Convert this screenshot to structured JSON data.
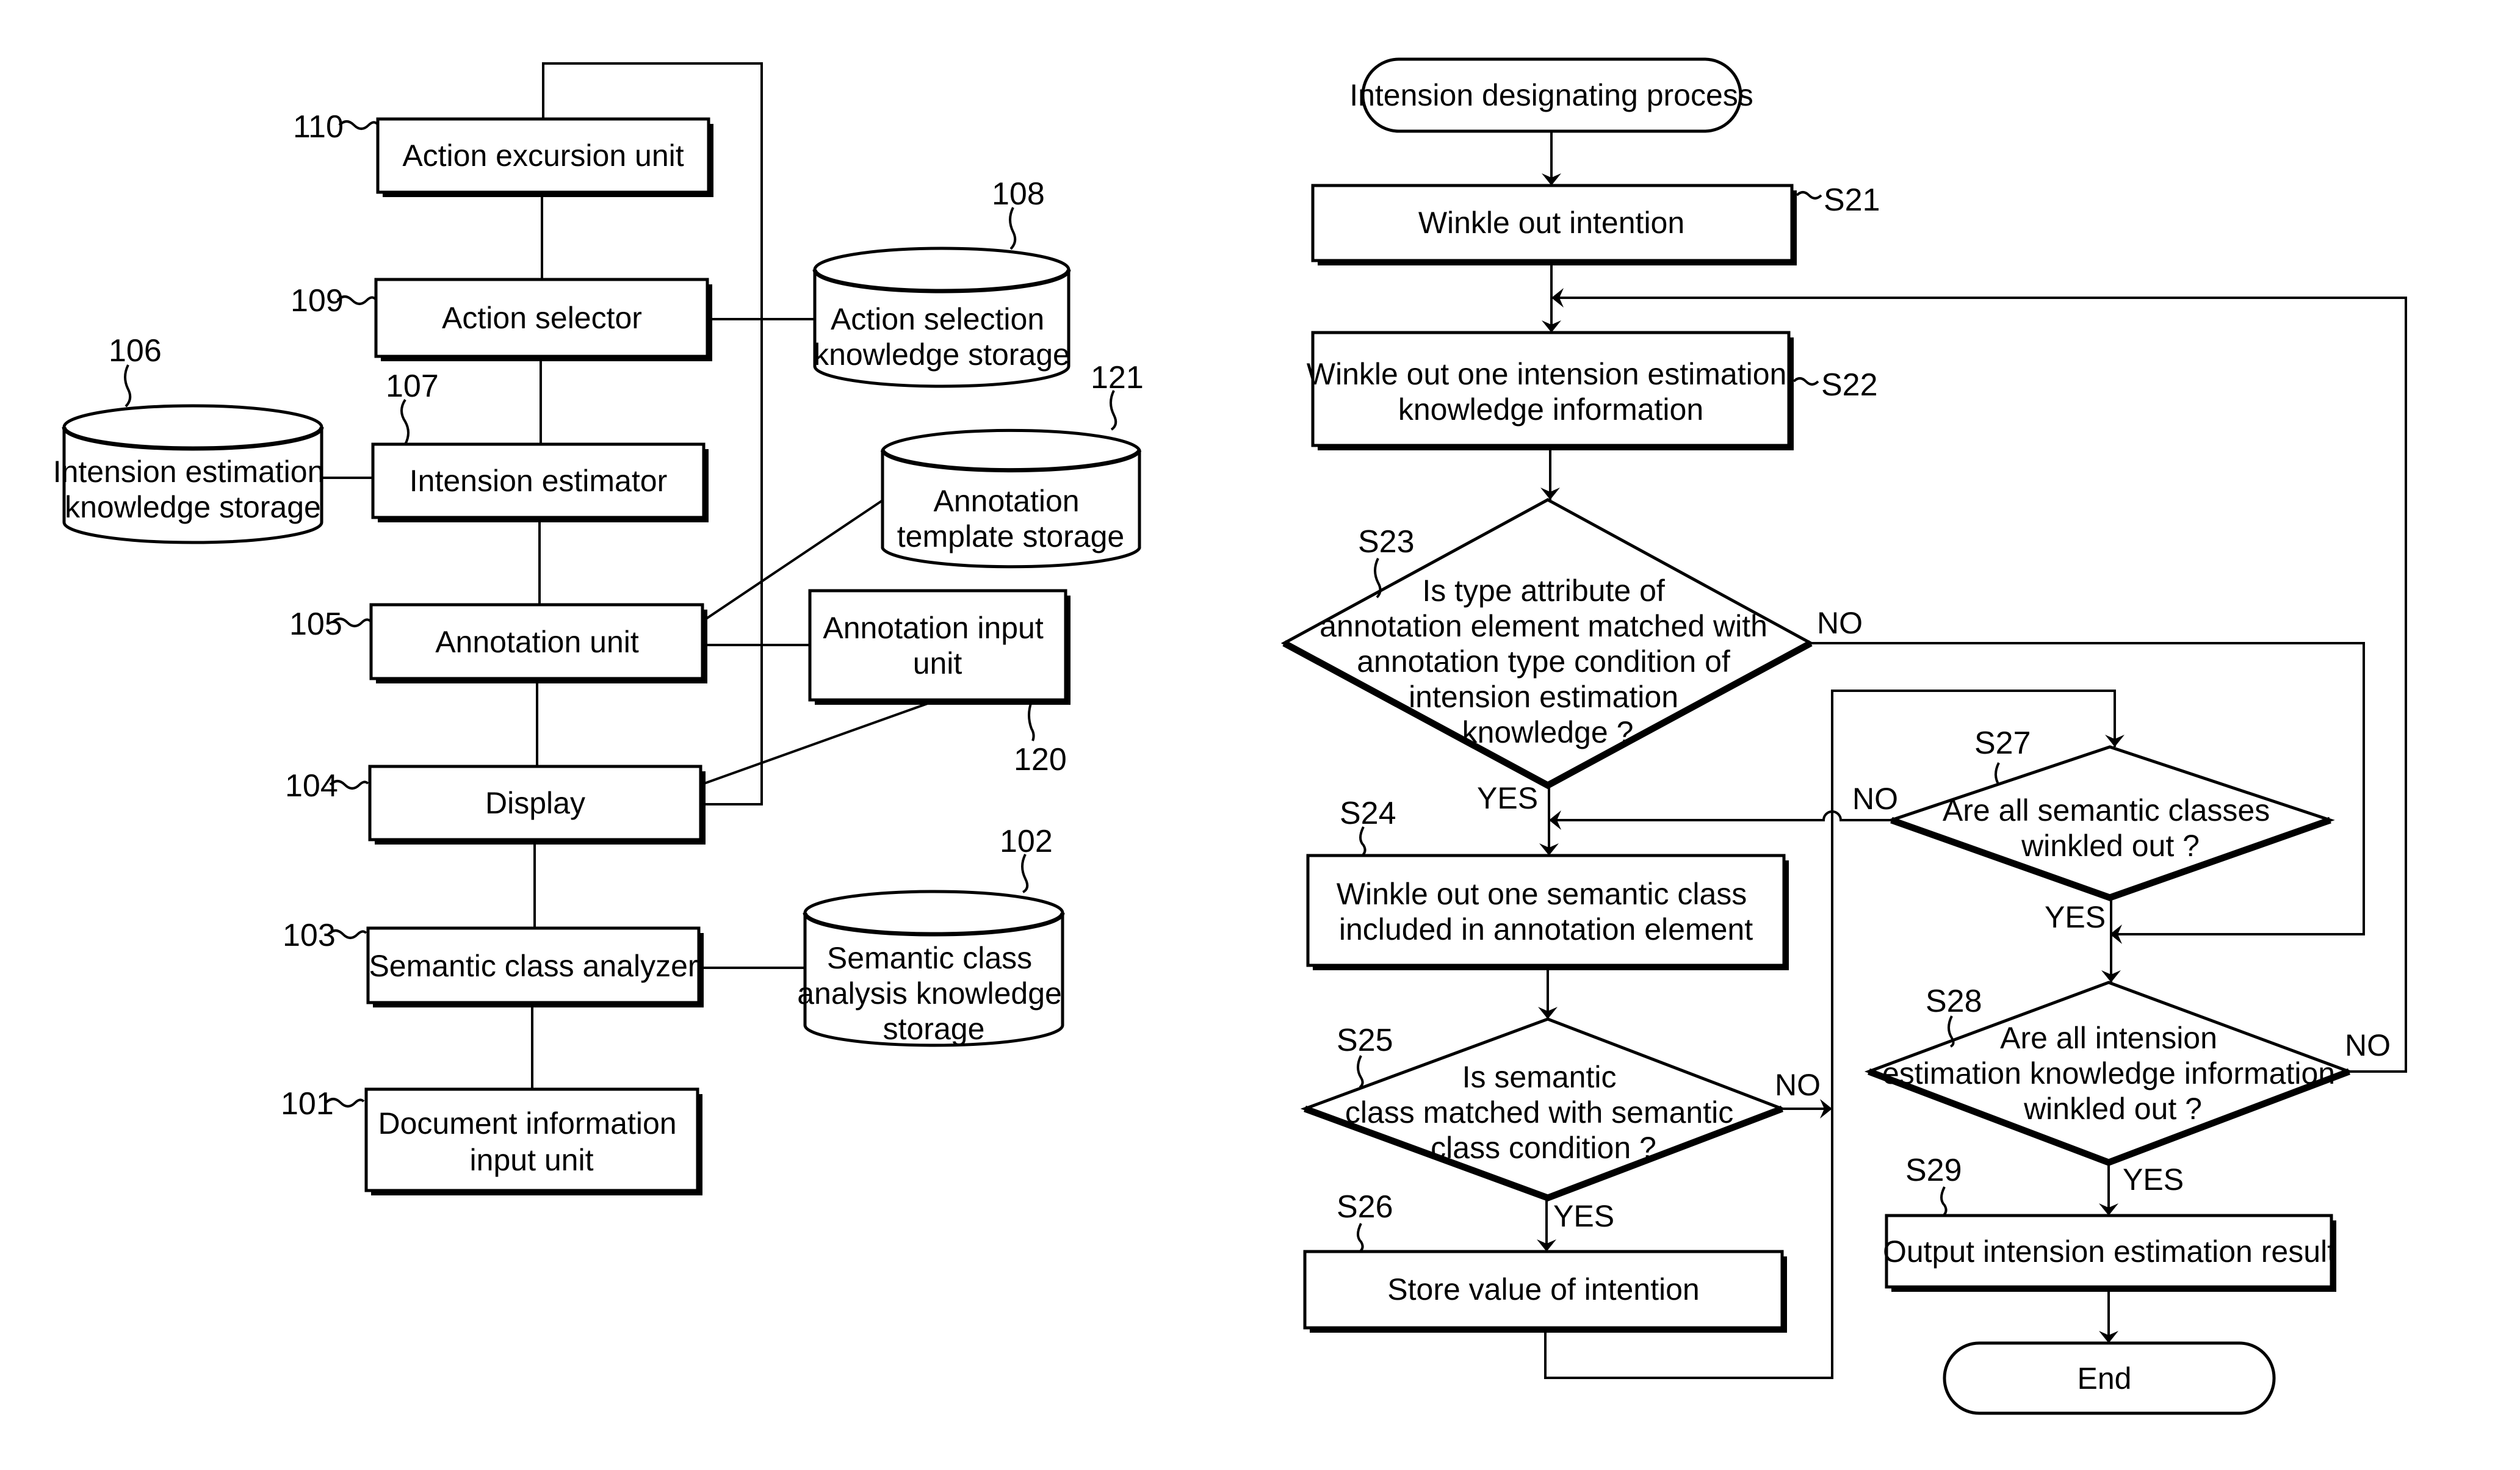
{
  "block_diagram": {
    "units": {
      "action_excursion": {
        "ref": "110",
        "label": [
          "Action excursion unit"
        ]
      },
      "action_selector": {
        "ref": "109",
        "label": [
          "Action selector"
        ]
      },
      "intension_estimator": {
        "ref": "107",
        "label": [
          "Intension estimator"
        ]
      },
      "annotation_unit": {
        "ref": "105",
        "label": [
          "Annotation unit"
        ]
      },
      "display": {
        "ref": "104",
        "label": [
          "Display"
        ]
      },
      "semantic_class_analyzer": {
        "ref": "103",
        "label": [
          "Semantic class analyzer"
        ]
      },
      "document_input": {
        "ref": "101",
        "label": [
          "Document information",
          "input unit"
        ]
      },
      "annotation_input": {
        "ref": "120",
        "label": [
          "Annotation input",
          "unit"
        ]
      }
    },
    "storages": {
      "action_selection_knowledge": {
        "ref": "108",
        "label": [
          "Action selection",
          "knowledge storage"
        ]
      },
      "intension_estimation_knowledge": {
        "ref": "106",
        "label": [
          "Intension estimation",
          "knowledge storage"
        ]
      },
      "annotation_template": {
        "ref": "121",
        "label": [
          "Annotation",
          "template storage"
        ]
      },
      "semantic_class_analysis_knowledge": {
        "ref": "102",
        "label": [
          "Semantic class",
          "analysis knowledge",
          "storage"
        ]
      }
    }
  },
  "flowchart": {
    "start": {
      "label": "Intension designating process"
    },
    "end": {
      "label": "End"
    },
    "steps": {
      "s21": {
        "id": "S21",
        "label": [
          "Winkle out intention"
        ]
      },
      "s22": {
        "id": "S22",
        "label": [
          "Winkle out one intension estimation",
          "knowledge information"
        ]
      },
      "s23": {
        "id": "S23",
        "label": [
          "Is type attribute of",
          "annotation element matched with",
          "annotation type condition of",
          "intension estimation",
          "knowledge ?"
        ]
      },
      "s24": {
        "id": "S24",
        "label": [
          "Winkle out one semantic class",
          "included in annotation element"
        ]
      },
      "s25": {
        "id": "S25",
        "label": [
          "Is semantic",
          "class matched with semantic",
          "class condition ?"
        ]
      },
      "s26": {
        "id": "S26",
        "label": [
          "Store value of intention"
        ]
      },
      "s27": {
        "id": "S27",
        "label": [
          "Are all semantic classes",
          "winkled out ?"
        ]
      },
      "s28": {
        "id": "S28",
        "label": [
          "Are all intension",
          "estimation knowledge information",
          "winkled out ?"
        ]
      },
      "s29": {
        "id": "S29",
        "label": [
          "Output intension estimation result"
        ]
      }
    },
    "branch_labels": {
      "yes": "YES",
      "no": "NO"
    }
  }
}
